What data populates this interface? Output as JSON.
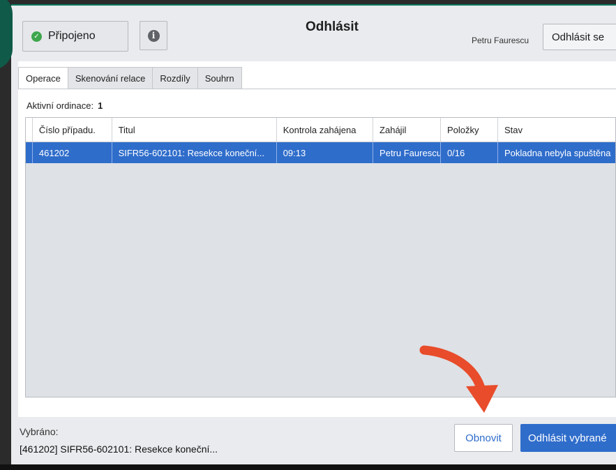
{
  "header": {
    "status_label": "Připojeno",
    "title": "Odhlásit",
    "user_name": "Petru Faurescu",
    "logout_label": "Odhlásit se"
  },
  "tabs": [
    {
      "label": "Operace",
      "active": true
    },
    {
      "label": "Skenování relace",
      "active": false
    },
    {
      "label": "Rozdíly",
      "active": false
    },
    {
      "label": "Souhrn",
      "active": false
    }
  ],
  "active_count": {
    "label": "Aktivní ordinace:",
    "value": "1"
  },
  "table": {
    "columns": [
      "Číslo případu.",
      "Titul",
      "Kontrola zahájena",
      "Zahájil",
      "Položky",
      "Stav"
    ],
    "rows": [
      [
        "461202",
        "SIFR56-602101: Resekce koneční...",
        "09:13",
        "Petru Faurescu",
        "0/16",
        "Pokladna nebyla spuštěna"
      ]
    ]
  },
  "footer": {
    "selected_label": "Vybráno:",
    "selected_value": "[461202] SIFR56-602101: Resekce koneční...",
    "refresh_label": "Obnovit",
    "logout_selected_label": "Odhlásit vybrané"
  },
  "colors": {
    "accent": "#2f6dcb",
    "status_ok": "#3ea64d",
    "annotation_arrow": "#e84c2b"
  },
  "icons": [
    "check-circle-icon",
    "info-icon",
    "curved-arrow-icon"
  ]
}
